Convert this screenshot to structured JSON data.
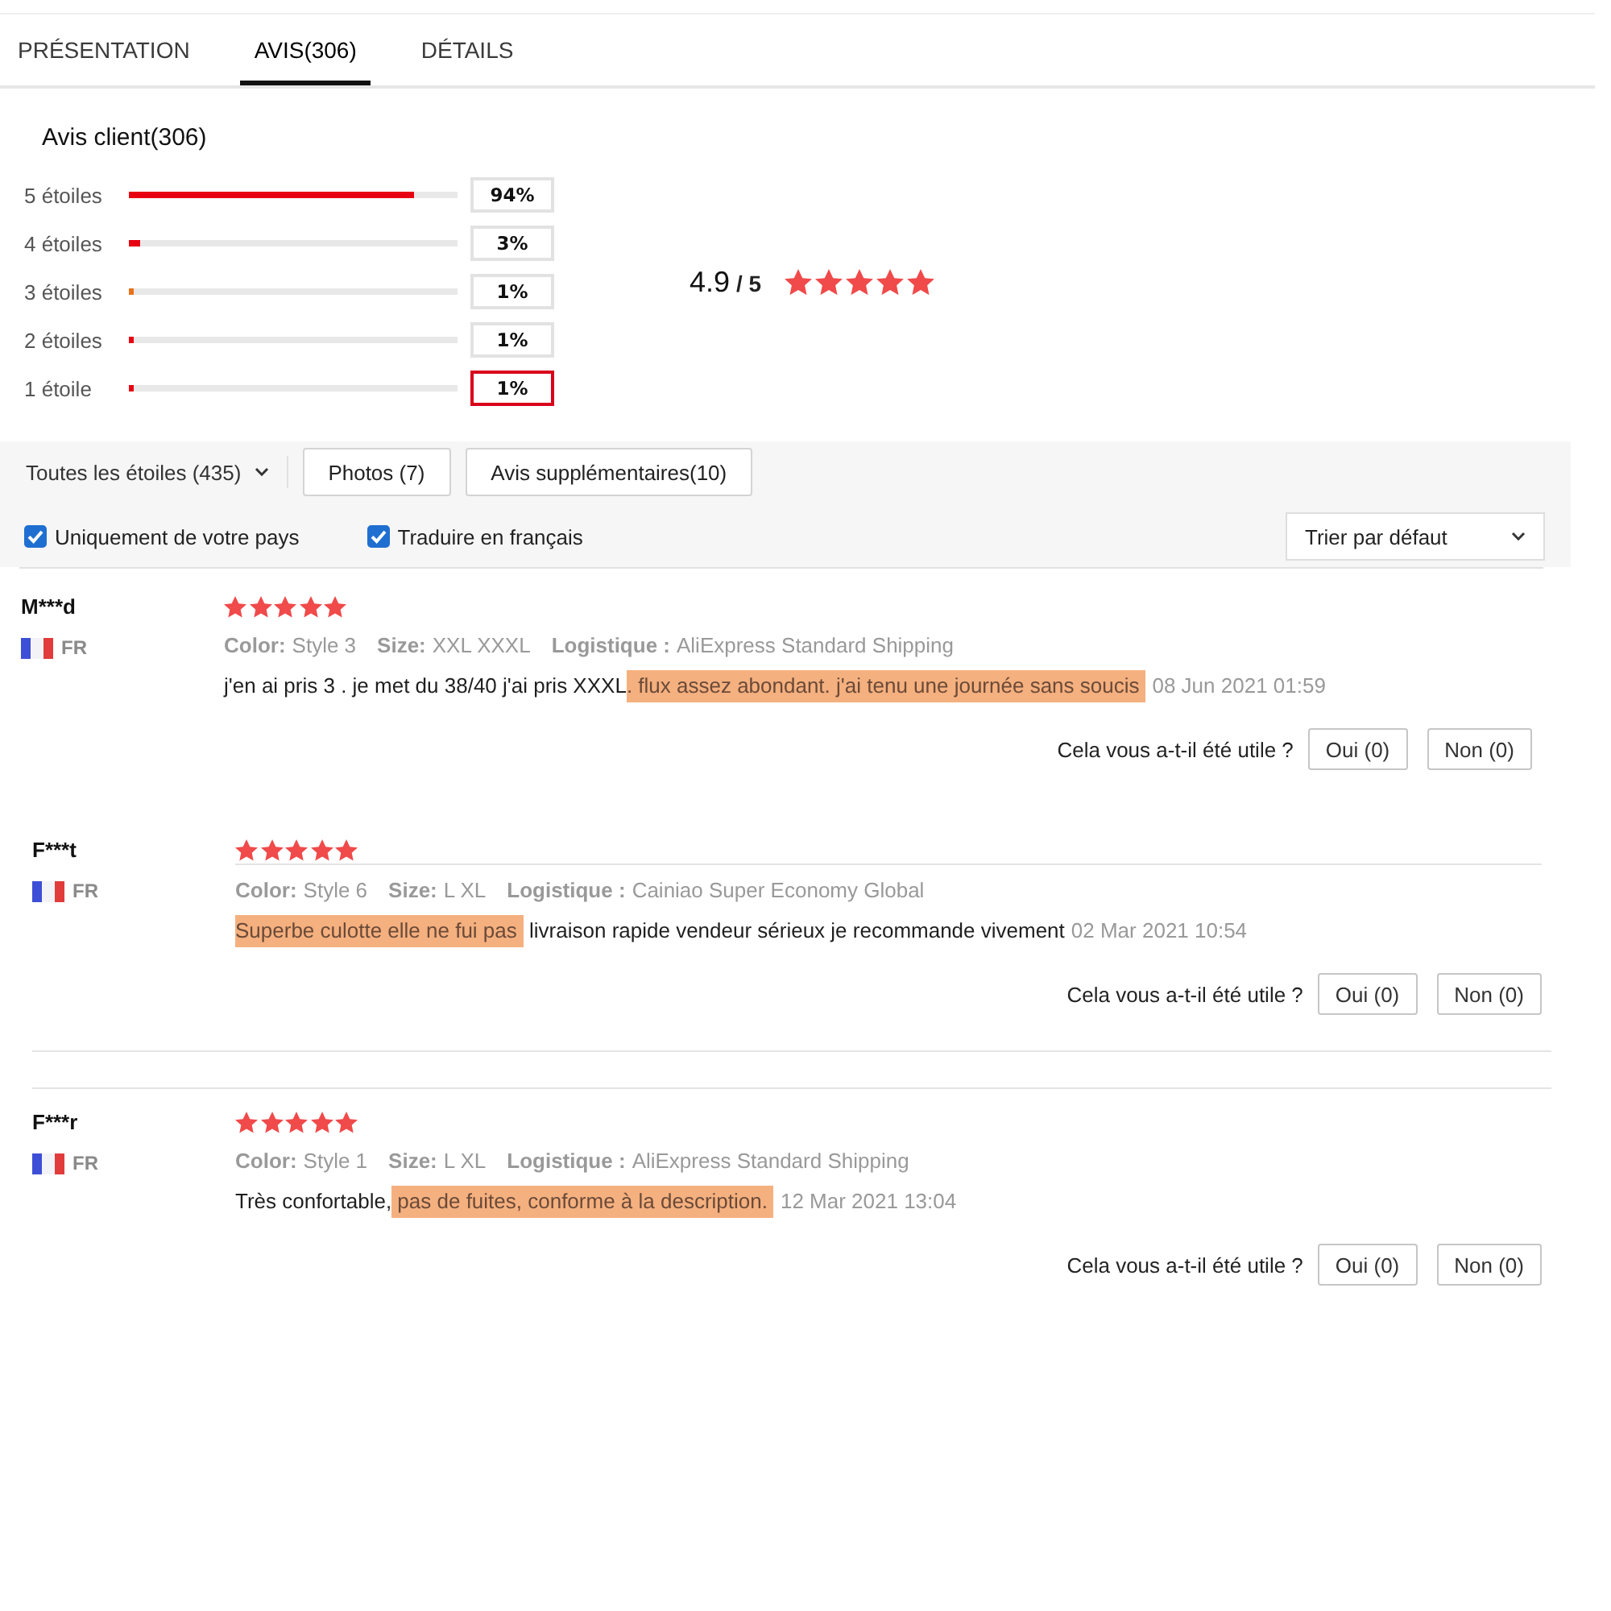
{
  "tabs": [
    {
      "label": "PRÉSENTATION",
      "selected": false
    },
    {
      "label": "AVIS(306)",
      "selected": true
    },
    {
      "label": "DÉTAILS",
      "selected": false
    }
  ],
  "summary": {
    "title": "Avis client(306)",
    "breakdown": [
      {
        "label": "5 étoiles",
        "level": 0.87,
        "color": "#e60012",
        "percent": "94%",
        "selected": false
      },
      {
        "label": "4 étoiles",
        "level": 0.035,
        "color": "#e60012",
        "percent": "3%",
        "selected": false
      },
      {
        "label": "3 étoiles",
        "level": 0.017,
        "color": "#e8731c",
        "percent": "1%",
        "selected": false
      },
      {
        "label": "2 étoiles",
        "level": 0.015,
        "color": "#e60012",
        "percent": "1%",
        "selected": false
      },
      {
        "label": "1 étoile",
        "level": 0.015,
        "color": "#e60012",
        "percent": "1%",
        "selected": true
      }
    ],
    "average": "4.9",
    "scale": "/ 5",
    "stars": 5
  },
  "filters": {
    "star_filter": "Toutes les étoiles (435)",
    "buttons": [
      "Photos (7)",
      "Avis supplémentaires(10)"
    ],
    "checkboxes": [
      {
        "label": "Uniquement de votre pays",
        "checked": true
      },
      {
        "label": "Traduire en français",
        "checked": true
      }
    ],
    "sort": "Trier par défaut"
  },
  "reviews": [
    {
      "author": "M***d",
      "country": "FR",
      "stars": 5,
      "attributes": [
        {
          "name": "Color:",
          "value": "Style 3"
        },
        {
          "name": "Size:",
          "value": "XXL XXXL"
        },
        {
          "name": "Logistique :",
          "value": "AliExpress Standard Shipping"
        }
      ],
      "comment": [
        {
          "text": "j'en ai pris 3 . je met du 38/40 j'ai pris XXXL",
          "highlighted": false
        },
        {
          "text": ". flux assez abondant. j'ai tenu une journée sans soucis",
          "highlighted": true
        }
      ],
      "date": "08 Jun 2021 01:59",
      "helpful": {
        "question": "Cela vous a-t-il été utile ?",
        "buttons": [
          "Oui (0)",
          "Non (0)"
        ]
      }
    },
    {
      "author": "F***t",
      "country": "FR",
      "stars": 5,
      "attributes": [
        {
          "name": "Color:",
          "value": "Style 6"
        },
        {
          "name": "Size:",
          "value": "L XL"
        },
        {
          "name": "Logistique :",
          "value": "Cainiao Super Economy Global"
        }
      ],
      "comment": [
        {
          "text": "Superbe culotte elle ne fui pas",
          "highlighted": true
        },
        {
          "text": " livraison rapide vendeur sérieux je recommande vivement",
          "highlighted": false
        }
      ],
      "date": "02 Mar 2021 10:54",
      "helpful": {
        "question": "Cela vous a-t-il été utile ?",
        "buttons": [
          "Oui (0)",
          "Non (0)"
        ]
      }
    },
    {
      "author": "F***r",
      "country": "FR",
      "stars": 5,
      "attributes": [
        {
          "name": "Color:",
          "value": "Style 1"
        },
        {
          "name": "Size:",
          "value": "L XL"
        },
        {
          "name": "Logistique :",
          "value": "AliExpress Standard Shipping"
        }
      ],
      "comment": [
        {
          "text": "Très confortable,",
          "highlighted": false
        },
        {
          "text": " pas de fuites, conforme à la description.",
          "highlighted": true
        }
      ],
      "date": "12 Mar 2021 13:04",
      "helpful": {
        "question": "Cela vous a-t-il été utile ?",
        "buttons": [
          "Oui (0)",
          "Non (0)"
        ]
      }
    }
  ]
}
